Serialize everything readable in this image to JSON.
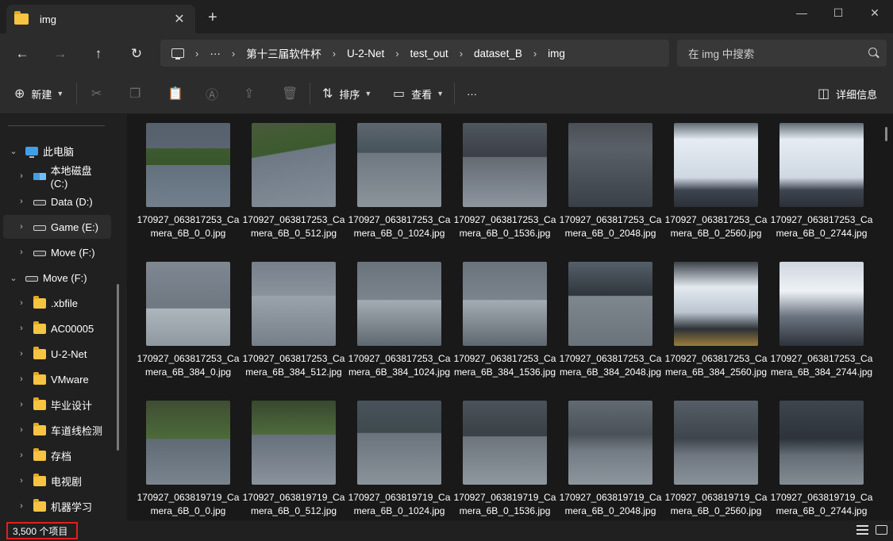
{
  "tab": {
    "title": "img",
    "close": "✕",
    "new": "+"
  },
  "window_controls": {
    "minimize": "—",
    "maximize": "☐",
    "close": "✕"
  },
  "nav": {
    "back": "←",
    "forward": "→",
    "up": "↑",
    "refresh": "↻"
  },
  "address": {
    "ellipsis": "···",
    "crumbs": [
      "第十三届软件杯",
      "U-2-Net",
      "test_out",
      "dataset_B",
      "img"
    ],
    "sep": "›"
  },
  "search": {
    "placeholder": "在 img 中搜索"
  },
  "commands": {
    "new_label": "新建",
    "sort_label": "排序",
    "view_label": "查看",
    "more": "···",
    "details_label": "详细信息"
  },
  "sidebar": {
    "items": [
      {
        "label": "此电脑",
        "icon": "monitor-icon",
        "expanded": true
      },
      {
        "label": "本地磁盘 (C:)",
        "icon": "system-drive-icon"
      },
      {
        "label": "Data (D:)",
        "icon": "drive-icon"
      },
      {
        "label": "Game (E:)",
        "icon": "drive-icon",
        "selected": true
      },
      {
        "label": "Move (F:)",
        "icon": "drive-icon"
      },
      {
        "label": "Move (F:)",
        "icon": "drive-icon",
        "expanded": true
      },
      {
        "label": ".xbfile",
        "icon": "folder-icon"
      },
      {
        "label": "AC00005",
        "icon": "folder-icon"
      },
      {
        "label": "U-2-Net",
        "icon": "folder-icon"
      },
      {
        "label": "VMware",
        "icon": "folder-icon"
      },
      {
        "label": "毕业设计",
        "icon": "folder-icon"
      },
      {
        "label": "车道线检测",
        "icon": "folder-icon"
      },
      {
        "label": "存档",
        "icon": "folder-icon"
      },
      {
        "label": "电视剧",
        "icon": "folder-icon"
      },
      {
        "label": "机器学习",
        "icon": "folder-icon"
      }
    ]
  },
  "files": [
    {
      "name": "170927_063817253_Camera_6B_0_0.jpg",
      "scene": "sc-road-grass"
    },
    {
      "name": "170927_063817253_Camera_6B_0_512.jpg",
      "scene": "sc-road-grass2"
    },
    {
      "name": "170927_063817253_Camera_6B_0_1024.jpg",
      "scene": "sc-street"
    },
    {
      "name": "170927_063817253_Camera_6B_0_1536.jpg",
      "scene": "sc-sidewalk"
    },
    {
      "name": "170927_063817253_Camera_6B_0_2048.jpg",
      "scene": "sc-truck"
    },
    {
      "name": "170927_063817253_Camera_6B_0_2560.jpg",
      "scene": "sc-kuaidi"
    },
    {
      "name": "170927_063817253_Camera_6B_0_2744.jpg",
      "scene": "sc-kuaidi"
    },
    {
      "name": "170927_063817253_Camera_6B_384_0.jpg",
      "scene": "sc-hood-road"
    },
    {
      "name": "170927_063817253_Camera_6B_384_512.jpg",
      "scene": "sc-hood"
    },
    {
      "name": "170927_063817253_Camera_6B_384_1024.jpg",
      "scene": "sc-hood2"
    },
    {
      "name": "170927_063817253_Camera_6B_384_1536.jpg",
      "scene": "sc-hood2"
    },
    {
      "name": "170927_063817253_Camera_6B_384_2048.jpg",
      "scene": "sc-darkside"
    },
    {
      "name": "170927_063817253_Camera_6B_384_2560.jpg",
      "scene": "sc-truck2"
    },
    {
      "name": "170927_063817253_Camera_6B_384_2744.jpg",
      "scene": "sc-kuaidi2"
    },
    {
      "name": "170927_063819719_Camera_6B_0_0.jpg",
      "scene": "sc-bushes"
    },
    {
      "name": "170927_063819719_Camera_6B_0_512.jpg",
      "scene": "sc-bushes2"
    },
    {
      "name": "170927_063819719_Camera_6B_0_1024.jpg",
      "scene": "sc-street2"
    },
    {
      "name": "170927_063819719_Camera_6B_0_1536.jpg",
      "scene": "sc-street3"
    },
    {
      "name": "170927_063819719_Camera_6B_0_2048.jpg",
      "scene": "sc-people"
    },
    {
      "name": "170927_063819719_Camera_6B_0_2560.jpg",
      "scene": "sc-people2"
    },
    {
      "name": "170927_063819719_Camera_6B_0_2744.jpg",
      "scene": "sc-people3"
    }
  ],
  "status": {
    "count": "3,500 个项目"
  }
}
